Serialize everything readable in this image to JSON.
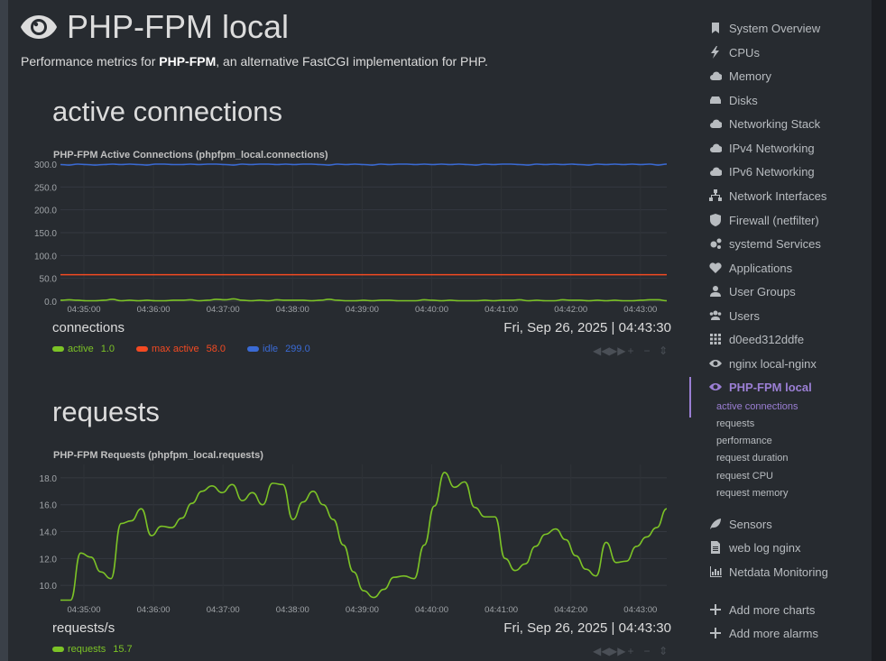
{
  "page": {
    "title": "PHP-FPM local",
    "desc_pre": "Performance metrics for ",
    "desc_bold": "PHP-FPM",
    "desc_post": ", an alternative FastCGI implementation for PHP."
  },
  "sections": [
    {
      "title": "active connections",
      "chart_title": "PHP-FPM Active Connections (phpfpm_local.connections)",
      "units": "connections",
      "timestamp": "Fri, Sep 26, 2025 | 04:43:30",
      "legend": [
        {
          "name": "active",
          "value": "1.0",
          "color": "#7cc326"
        },
        {
          "name": "max active",
          "value": "58.0",
          "color": "#f34a22"
        },
        {
          "name": "idle",
          "value": "299.0",
          "color": "#3a6ad4"
        }
      ]
    },
    {
      "title": "requests",
      "chart_title": "PHP-FPM Requests (phpfpm_local.requests)",
      "units": "requests/s",
      "timestamp": "Fri, Sep 26, 2025 | 04:43:30",
      "legend": [
        {
          "name": "requests",
          "value": "15.7",
          "color": "#7cc326"
        }
      ]
    }
  ],
  "chart_data": [
    {
      "type": "line",
      "title": "PHP-FPM Active Connections (phpfpm_local.connections)",
      "ylabel": "connections",
      "ylim": [
        0,
        300
      ],
      "yticks": [
        "300.0",
        "250.0",
        "200.0",
        "150.0",
        "100.0",
        "50.0",
        "0.0"
      ],
      "x": [
        "04:35:00",
        "04:36:00",
        "04:37:00",
        "04:38:00",
        "04:39:00",
        "04:40:00",
        "04:41:00",
        "04:42:00",
        "04:43:00"
      ],
      "series": [
        {
          "name": "idle",
          "color": "#3a6ad4",
          "values": [
            299,
            298,
            300,
            299,
            298,
            299,
            300,
            299,
            300,
            299,
            298,
            300,
            300,
            299,
            299,
            300,
            299,
            300,
            300,
            299,
            298,
            300,
            299,
            300,
            300,
            299,
            300,
            299,
            300,
            300,
            299,
            298,
            300,
            299,
            300,
            299,
            298,
            300,
            299,
            300,
            300,
            299,
            300,
            299,
            300,
            299,
            300,
            299,
            298,
            300,
            299,
            300,
            300,
            299,
            298,
            300,
            299,
            300,
            299,
            300,
            299,
            298,
            300,
            299,
            300,
            299,
            300,
            299,
            300,
            298,
            300
          ]
        },
        {
          "name": "max active",
          "color": "#f34a22",
          "values": [
            58,
            58,
            58,
            58,
            58,
            58,
            58,
            58,
            58,
            58,
            58,
            58,
            58,
            58,
            58,
            58,
            58,
            58,
            58,
            58,
            58,
            58,
            58,
            58,
            58,
            58,
            58,
            58,
            58,
            58,
            58,
            58,
            58,
            58,
            58,
            58,
            58,
            58,
            58,
            58,
            58,
            58,
            58,
            58,
            58,
            58,
            58,
            58,
            58,
            58,
            58,
            58,
            58,
            58,
            58,
            58,
            58,
            58,
            58,
            58,
            58,
            58,
            58,
            58,
            58,
            58,
            58,
            58,
            58,
            58,
            58
          ]
        },
        {
          "name": "active",
          "color": "#7cc326",
          "values": [
            2,
            3,
            2,
            1,
            1,
            2,
            4,
            1,
            2,
            1,
            2,
            1,
            1,
            2,
            2,
            3,
            1,
            2,
            4,
            3,
            5,
            2,
            1,
            2,
            1,
            3,
            2,
            2,
            2,
            1,
            2,
            4,
            2,
            1,
            1,
            2,
            1,
            2,
            2,
            1,
            1,
            1,
            3,
            2,
            1,
            2,
            1,
            1,
            1,
            2,
            1,
            2,
            2,
            3,
            1,
            2,
            1,
            1,
            3,
            2,
            2,
            1,
            2,
            1,
            2,
            1,
            1,
            2,
            3,
            3,
            1
          ]
        }
      ]
    },
    {
      "type": "line",
      "title": "PHP-FPM Requests (phpfpm_local.requests)",
      "ylabel": "requests/s",
      "ylim": [
        8.8,
        19
      ],
      "yticks": [
        "18.0",
        "16.0",
        "14.0",
        "12.0",
        "10.0"
      ],
      "x": [
        "04:35:00",
        "04:36:00",
        "04:37:00",
        "04:38:00",
        "04:39:00",
        "04:40:00",
        "04:41:00",
        "04:42:00",
        "04:43:00"
      ],
      "series": [
        {
          "name": "requests",
          "color": "#7cc326",
          "values": [
            8.9,
            8.9,
            12.4,
            12.1,
            11.0,
            10.5,
            14.6,
            14.8,
            15.7,
            13.7,
            14.4,
            14.3,
            15.0,
            16.1,
            17.0,
            17.4,
            16.9,
            17.5,
            16.3,
            16.9,
            16.0,
            17.6,
            17.5,
            14.9,
            16.2,
            17.0,
            16.0,
            14.9,
            13.0,
            11.0,
            9.6,
            9.1,
            9.7,
            10.6,
            10.7,
            10.5,
            13.0,
            15.9,
            18.4,
            17.3,
            17.7,
            15.8,
            15.1,
            15.1,
            12.0,
            11.1,
            11.6,
            12.9,
            13.8,
            14.2,
            13.4,
            12.2,
            11.2,
            10.7,
            13.2,
            11.7,
            11.8,
            12.9,
            13.6,
            14.3,
            15.7
          ]
        }
      ]
    }
  ],
  "sidebar": {
    "items": [
      {
        "label": "System Overview",
        "icon": "bookmark-icon"
      },
      {
        "label": "CPUs",
        "icon": "bolt-icon"
      },
      {
        "label": "Memory",
        "icon": "cloud-icon"
      },
      {
        "label": "Disks",
        "icon": "hdd-icon"
      },
      {
        "label": "Networking Stack",
        "icon": "cloud-icon"
      },
      {
        "label": "IPv4 Networking",
        "icon": "cloud-icon"
      },
      {
        "label": "IPv6 Networking",
        "icon": "cloud-icon"
      },
      {
        "label": "Network Interfaces",
        "icon": "sitemap-icon"
      },
      {
        "label": "Firewall (netfilter)",
        "icon": "shield-icon"
      },
      {
        "label": "systemd Services",
        "icon": "cogs-icon"
      },
      {
        "label": "Applications",
        "icon": "heartbeat-icon"
      },
      {
        "label": "User Groups",
        "icon": "user-icon"
      },
      {
        "label": "Users",
        "icon": "users-icon"
      },
      {
        "label": "d0eed312ddfe",
        "icon": "th-icon"
      },
      {
        "label": "nginx local-nginx",
        "icon": "eye-icon"
      },
      {
        "label": "PHP-FPM local",
        "icon": "eye-icon"
      }
    ],
    "sub_items": [
      "active connections",
      "requests",
      "performance",
      "request duration",
      "request CPU",
      "request memory"
    ],
    "items_after": [
      {
        "label": "Sensors",
        "icon": "leaf-icon"
      },
      {
        "label": "web log nginx",
        "icon": "file-icon"
      },
      {
        "label": "Netdata Monitoring",
        "icon": "bar-chart-icon"
      }
    ],
    "actions": [
      {
        "label": "Add more charts",
        "icon": "plus-icon"
      },
      {
        "label": "Add more alarms",
        "icon": "plus-icon"
      }
    ]
  },
  "colors": {
    "background": "#272b30",
    "accent": "#9b7fd4",
    "grid": "#34383e"
  }
}
